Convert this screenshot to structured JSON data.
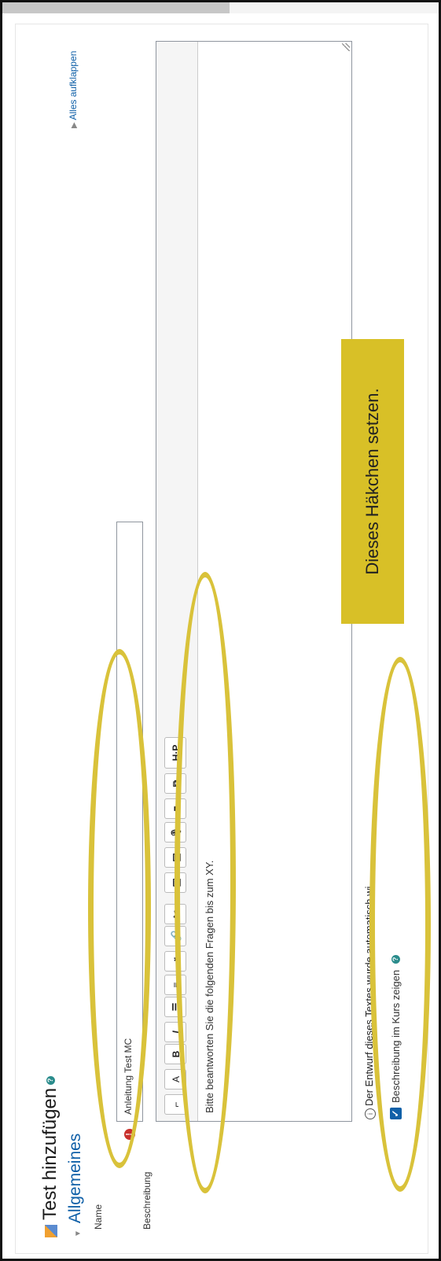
{
  "topbar": {
    "progress_percent": 52
  },
  "page": {
    "title": "Test hinzufügen",
    "title_icon": "pencil-doc-icon",
    "help_glyph": "?"
  },
  "section": {
    "toggle_glyph": "▼",
    "title": "Allgemeines",
    "expand_all_glyph": "▶",
    "expand_all": "Alles aufklappen"
  },
  "form": {
    "name_label": "Name",
    "name_value": "Anleitung Test MC",
    "required_glyph": "!",
    "description_label": "Beschreibung",
    "description_text": "Bitte beantworten Sie die folgenden Fragen bis zum XY.",
    "toolbar": [
      {
        "name": "collapse-toolbar-button",
        "glyph": "⌐"
      },
      {
        "name": "font-style-button",
        "glyph": "A"
      },
      {
        "name": "bold-button",
        "glyph": "B"
      },
      {
        "name": "italic-button",
        "glyph": "I"
      },
      {
        "name": "unordered-list-button",
        "glyph": "☰"
      },
      {
        "name": "ordered-list-button",
        "glyph": "≡"
      },
      {
        "name": "indent-button",
        "glyph": "⇥"
      },
      {
        "name": "link-button",
        "glyph": "🔗"
      },
      {
        "name": "unlink-button",
        "glyph": "✂"
      },
      {
        "name": "image-button",
        "glyph": "▣"
      },
      {
        "name": "media-button",
        "glyph": "▤"
      },
      {
        "name": "record-audio-button",
        "glyph": "🎙"
      },
      {
        "name": "record-video-button",
        "glyph": "■"
      },
      {
        "name": "manage-files-button",
        "glyph": "⧉"
      },
      {
        "name": "h5p-button",
        "glyph": "H·P"
      }
    ],
    "autosave_glyph": "i",
    "autosave_notice": "Der Entwurf dieses Textes wurde automatisch wi",
    "show_description_label": "Beschreibung im Kurs zeigen",
    "show_description_checked": true,
    "checkbox_glyph": "✓"
  },
  "annotation": {
    "callout": "Dieses Häkchen setzen."
  },
  "colors": {
    "accent": "#1060a8",
    "highlight": "#d8c027",
    "required": "#c9302c",
    "help": "#2a8c8c"
  }
}
